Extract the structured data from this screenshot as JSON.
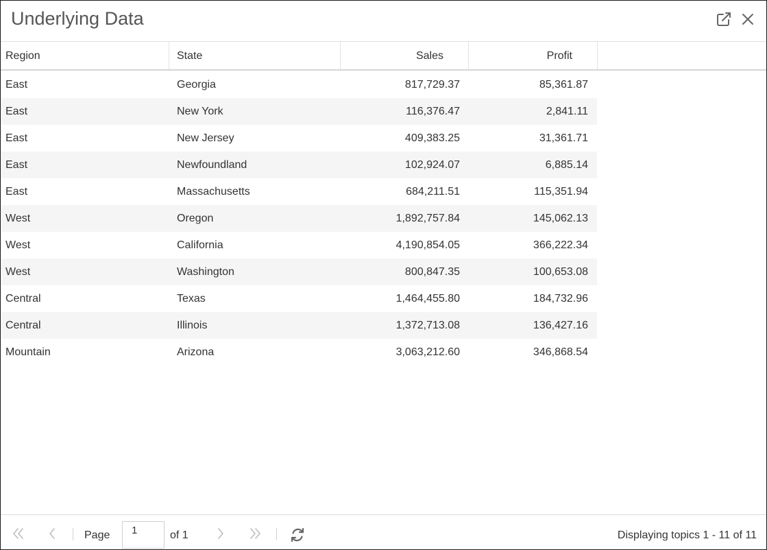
{
  "dialog": {
    "title": "Underlying Data",
    "icons": {
      "popout": "external-link-icon",
      "close": "close-icon"
    }
  },
  "grid": {
    "columns": [
      "Region",
      "State",
      "Sales",
      "Profit"
    ],
    "rows": [
      [
        "East",
        "Georgia",
        "817,729.37",
        "85,361.87"
      ],
      [
        "East",
        "New York",
        "116,376.47",
        "2,841.11"
      ],
      [
        "East",
        "New Jersey",
        "409,383.25",
        "31,361.71"
      ],
      [
        "East",
        "Newfoundland",
        "102,924.07",
        "6,885.14"
      ],
      [
        "East",
        "Massachusetts",
        "684,211.51",
        "115,351.94"
      ],
      [
        "West",
        "Oregon",
        "1,892,757.84",
        "145,062.13"
      ],
      [
        "West",
        "California",
        "4,190,854.05",
        "366,222.34"
      ],
      [
        "West",
        "Washington",
        "800,847.35",
        "100,653.08"
      ],
      [
        "Central",
        "Texas",
        "1,464,455.80",
        "184,732.96"
      ],
      [
        "Central",
        "Illinois",
        "1,372,713.08",
        "136,427.16"
      ],
      [
        "Mountain",
        "Arizona",
        "3,063,212.60",
        "346,868.54"
      ]
    ]
  },
  "pager": {
    "page_label": "Page",
    "page_value": "1",
    "of_label": "of 1",
    "display_info": "Displaying topics 1 - 11 of 11",
    "icons": {
      "first": "double-chevron-left-icon",
      "prev": "chevron-left-icon",
      "next": "chevron-right-icon",
      "last": "double-chevron-right-icon",
      "refresh": "refresh-icon"
    }
  },
  "colors": {
    "border": "#1a1a1a",
    "alt_row": "#f5f5f5",
    "disabled_icon": "#bdbdbd",
    "icon": "#666666"
  }
}
